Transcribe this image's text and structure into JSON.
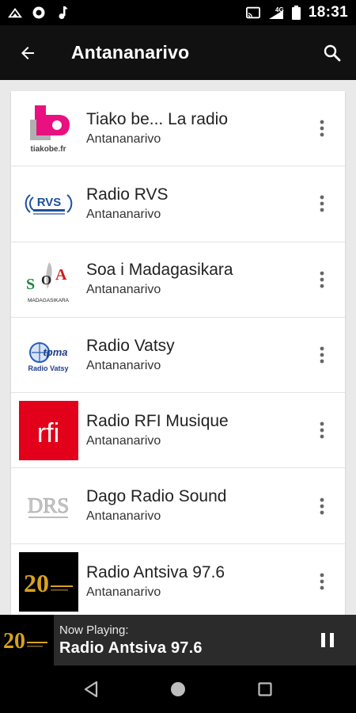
{
  "status_bar": {
    "time": "18:31",
    "icons_left": [
      "upload-icon",
      "settings-icon",
      "music-note-icon"
    ],
    "icons_right": [
      "cast-icon",
      "wifi-4g-icon",
      "signal-icon",
      "battery-icon"
    ],
    "network_label": "4G"
  },
  "app_bar": {
    "title": "Antananarivo",
    "back_icon": "arrow-left-icon",
    "search_icon": "search-icon"
  },
  "stations": [
    {
      "name": "Tiako be... La radio",
      "city": "Antananarivo",
      "logo_text": "tiakobe.fr"
    },
    {
      "name": "Radio RVS",
      "city": "Antananarivo",
      "logo_text": "RVS"
    },
    {
      "name": "Soa i Madagasikara",
      "city": "Antananarivo",
      "logo_text": "SOA",
      "logo_caption": "MADAGASIKARA"
    },
    {
      "name": "Radio Vatsy",
      "city": "Antananarivo",
      "logo_text": "tpma",
      "logo_caption": "Radio Vatsy"
    },
    {
      "name": "Radio RFI Musique",
      "city": "Antananarivo",
      "logo_text": "rfi"
    },
    {
      "name": "Dago Radio Sound",
      "city": "Antananarivo",
      "logo_text": "DRS"
    },
    {
      "name": "Radio Antsiva 97.6",
      "city": "Antananarivo",
      "logo_text": "20"
    }
  ],
  "now_playing": {
    "label": "Now Playing:",
    "title": "Radio Antsiva 97.6",
    "pause_icon": "pause-icon"
  },
  "nav_bar": {
    "icons": [
      "back-triangle-icon",
      "home-circle-icon",
      "recents-square-icon"
    ]
  },
  "colors": {
    "app_bar": "#111111",
    "background": "#e9e9e9",
    "tiako_pink": "#e8117f",
    "rfi_red": "#e2001a",
    "rvs_blue": "#1e4f9a"
  }
}
